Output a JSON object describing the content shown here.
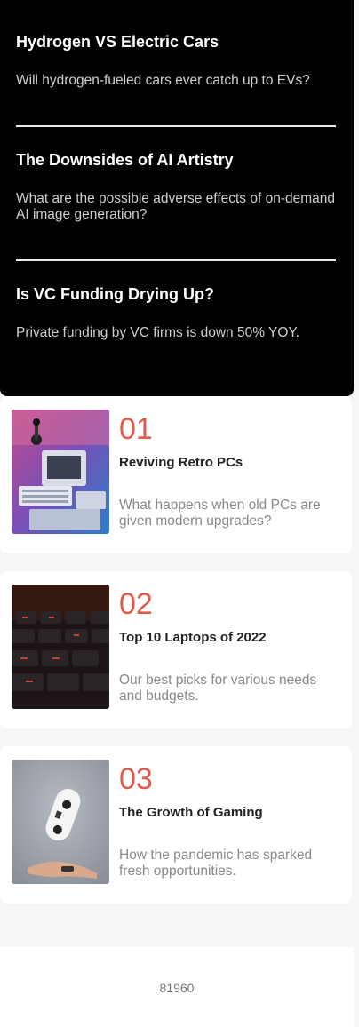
{
  "new_section": {
    "items": [
      {
        "title": "Hydrogen VS Electric Cars",
        "description": "Will hydrogen-fueled cars ever catch up to EVs?"
      },
      {
        "title": "The Downsides of AI Artistry",
        "description": "What are the possible adverse effects of on-demand AI image generation?"
      },
      {
        "title": "Is VC Funding Drying Up?",
        "description": "Private funding by VC firms is down 50% YOY."
      }
    ]
  },
  "top_articles": [
    {
      "number": "01",
      "title": "Reviving Retro PCs",
      "description": "What happens when old PCs are given modern upgrades?",
      "image": "retro-pc-image"
    },
    {
      "number": "02",
      "title": "Top 10 Laptops of 2022",
      "description": "Our best picks for various needs and budgets.",
      "image": "laptop-keyboard-image"
    },
    {
      "number": "03",
      "title": "The Growth of Gaming",
      "description": "How the pandemic has sparked fresh opportunities.",
      "image": "game-controller-image"
    }
  ],
  "footer": {
    "text": "81960"
  },
  "colors": {
    "accent": "#e05a4a",
    "panel": "#000000",
    "background": "#f6f6f7"
  }
}
